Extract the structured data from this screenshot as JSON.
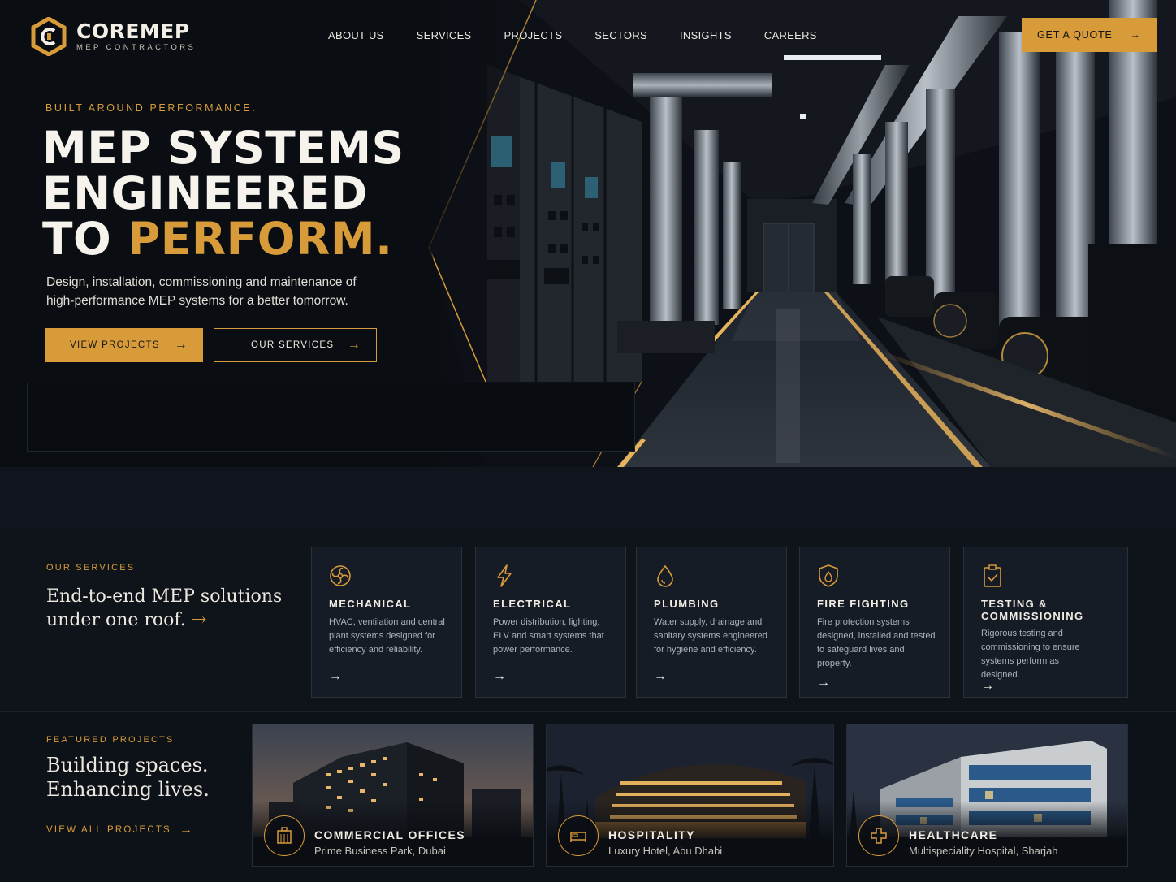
{
  "brand": {
    "name": "COREMEP",
    "tagline": "MEP CONTRACTORS"
  },
  "nav": {
    "items": [
      "ABOUT US",
      "SERVICES",
      "PROJECTS",
      "SECTORS",
      "INSIGHTS",
      "CAREERS"
    ]
  },
  "header": {
    "cta_label": "GET A QUOTE"
  },
  "hero": {
    "eyebrow": "BUILT AROUND PERFORMANCE.",
    "title_line1": "MEP SYSTEMS",
    "title_line2": "ENGINEERED",
    "title_line3_a": "TO",
    "title_line3_b": "PERFORM.",
    "description": "Design, installation, commissioning and maintenance of high-performance MEP systems for a better tomorrow.",
    "primary_label": "VIEW PROJECTS",
    "secondary_label": "OUR SERVICES"
  },
  "services": {
    "eyebrow": "OUR SERVICES",
    "heading": "End-to-end MEP solutions under one roof.",
    "cards": [
      {
        "title": "MECHANICAL",
        "desc": "HVAC, ventilation and central plant systems designed for efficiency and reliability.",
        "icon": "fan-icon"
      },
      {
        "title": "ELECTRICAL",
        "desc": "Power distribution, lighting, ELV and smart systems that power performance.",
        "icon": "lightning-icon"
      },
      {
        "title": "PLUMBING",
        "desc": "Water supply, drainage and sanitary systems engineered for hygiene and efficiency.",
        "icon": "water-drop-icon"
      },
      {
        "title": "FIRE FIGHTING",
        "desc": "Fire protection systems designed, installed and tested to safeguard lives and property.",
        "icon": "fire-shield-icon"
      },
      {
        "title": "TESTING & COMMISSIONING",
        "desc": "Rigorous testing and commissioning to ensure systems perform as designed.",
        "icon": "clipboard-check-icon"
      }
    ]
  },
  "projects": {
    "eyebrow": "FEATURED PROJECTS",
    "heading": "Building spaces. Enhancing lives.",
    "link_label": "VIEW ALL PROJECTS",
    "items": [
      {
        "title": "COMMERCIAL OFFICES",
        "subtitle": "Prime Business Park, Dubai",
        "icon": "office-building-icon"
      },
      {
        "title": "HOSPITALITY",
        "subtitle": "Luxury Hotel, Abu Dhabi",
        "icon": "bed-icon"
      },
      {
        "title": "HEALTHCARE",
        "subtitle": "Multispeciality Hospital, Sharjah",
        "icon": "medical-cross-icon"
      }
    ]
  },
  "colors": {
    "accent": "#d89b3a",
    "background": "#0c1118",
    "card": "#161c25"
  }
}
